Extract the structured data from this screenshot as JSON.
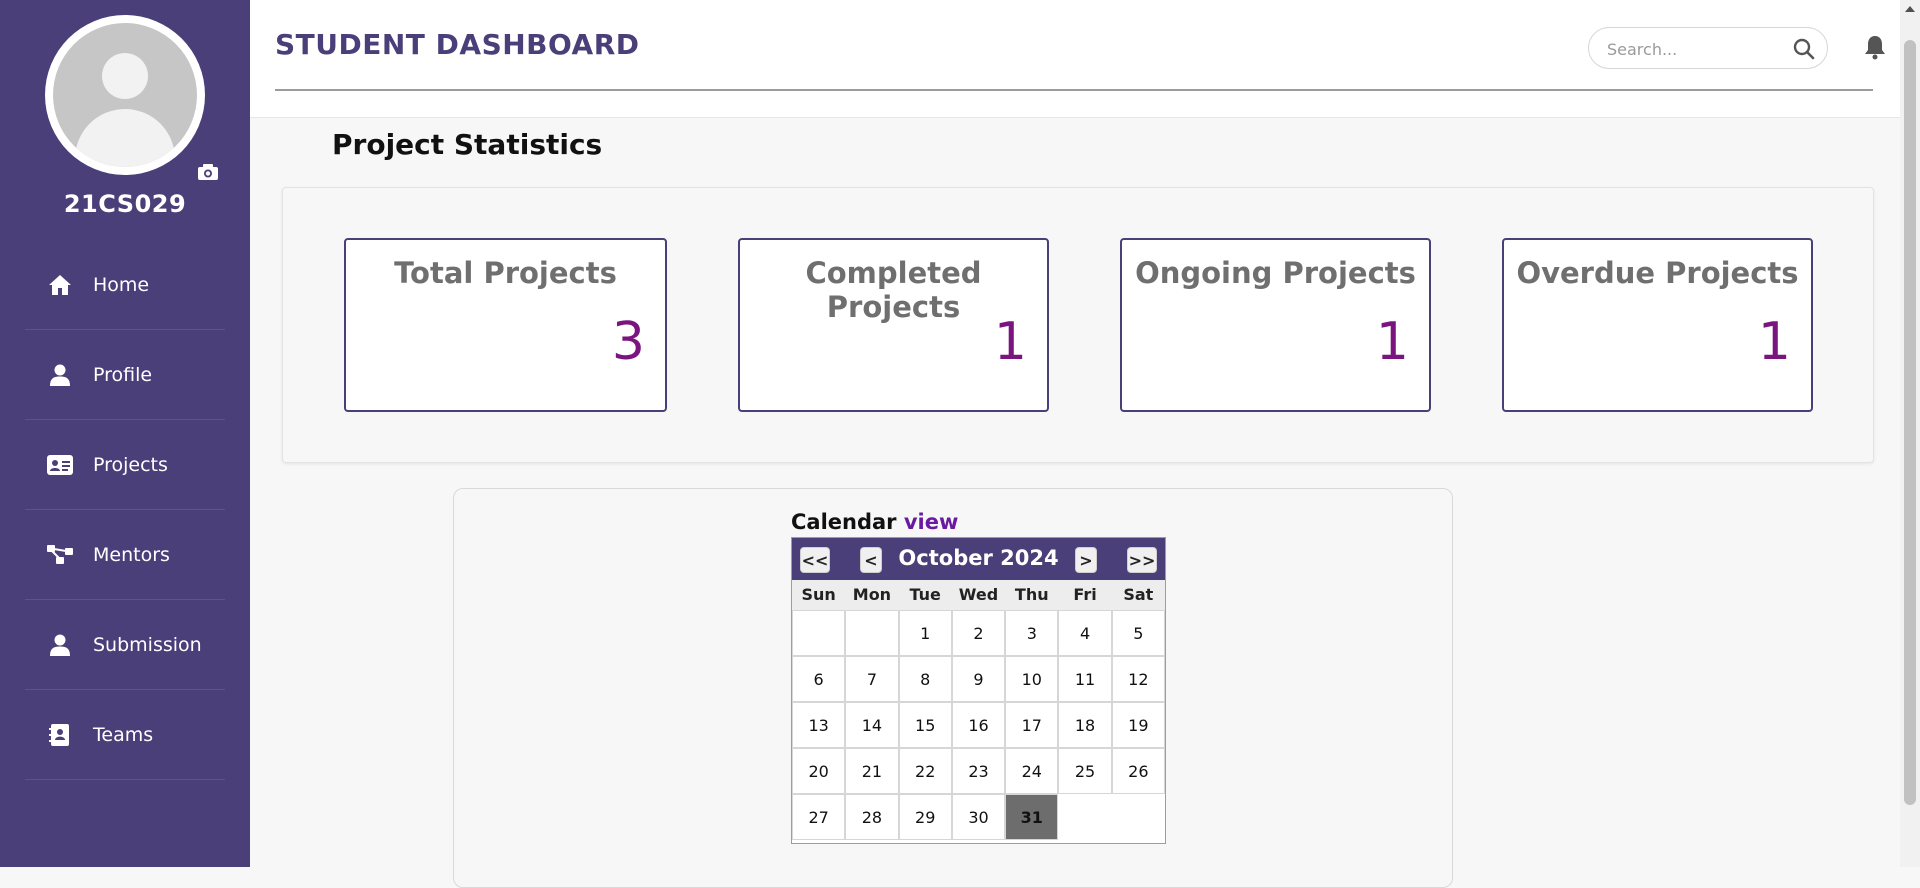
{
  "profile": {
    "user_id": "21CS029"
  },
  "sidebar": {
    "items": [
      {
        "label": "Home",
        "icon": "home-icon"
      },
      {
        "label": "Profile",
        "icon": "user-icon"
      },
      {
        "label": "Projects",
        "icon": "id-card-icon"
      },
      {
        "label": "Mentors",
        "icon": "network-icon"
      },
      {
        "label": "Submission",
        "icon": "user-icon"
      },
      {
        "label": "Teams",
        "icon": "address-book-icon"
      }
    ]
  },
  "header": {
    "title": "STUDENT DASHBOARD",
    "search_placeholder": "Search...",
    "search_icon": "search-icon",
    "bell_icon": "bell-icon"
  },
  "stats": {
    "section_title": "Project Statistics",
    "cards": [
      {
        "title": "Total Projects",
        "value": "3"
      },
      {
        "title": "Completed Projects",
        "value": "1"
      },
      {
        "title": "Ongoing Projects",
        "value": "1"
      },
      {
        "title": "Overdue Projects",
        "value": "1"
      }
    ]
  },
  "calendar": {
    "caption": "Calendar",
    "caption_link": "view",
    "month_label": "October 2024",
    "prev_year": "<<",
    "prev_month": "<",
    "next_month": ">",
    "next_year": ">>",
    "weekdays": [
      "Sun",
      "Mon",
      "Tue",
      "Wed",
      "Thu",
      "Fri",
      "Sat"
    ],
    "leading_blanks": 2,
    "days_in_month": 31,
    "highlighted_day": 31
  },
  "colors": {
    "sidebar": "#4a3f78",
    "accent_value": "#7a1580",
    "highlight": "#6d6d6d"
  }
}
